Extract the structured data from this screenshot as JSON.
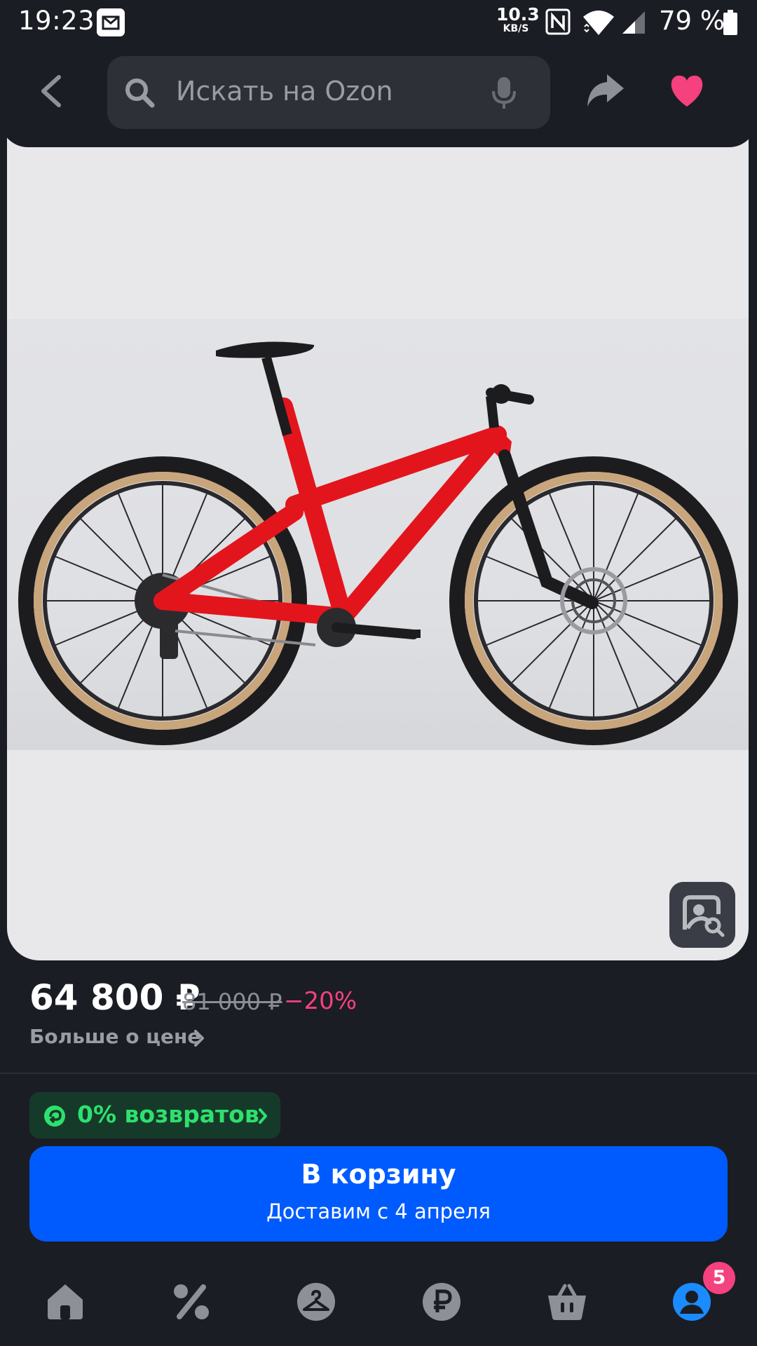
{
  "status_bar": {
    "time": "19:23",
    "net_speed_value": "10.3",
    "net_speed_unit": "KB/S",
    "battery_percent": "79 %"
  },
  "header": {
    "search_placeholder": "Искать на Ozon"
  },
  "product": {
    "price": "64 800 ₽",
    "old_price": "81 000 ₽",
    "discount": "−20%",
    "more_about_price": "Больше о цене",
    "returns_badge": "0% возвратов"
  },
  "cart_button": {
    "title": "В корзину",
    "subtitle": "Доставим с 4 апреля"
  },
  "bottom_nav": {
    "profile_badge": "5"
  },
  "colors": {
    "background": "#1b1d24",
    "accent_blue": "#005bff",
    "discount_pink": "#f5417e",
    "returns_green": "#2ee06e"
  }
}
